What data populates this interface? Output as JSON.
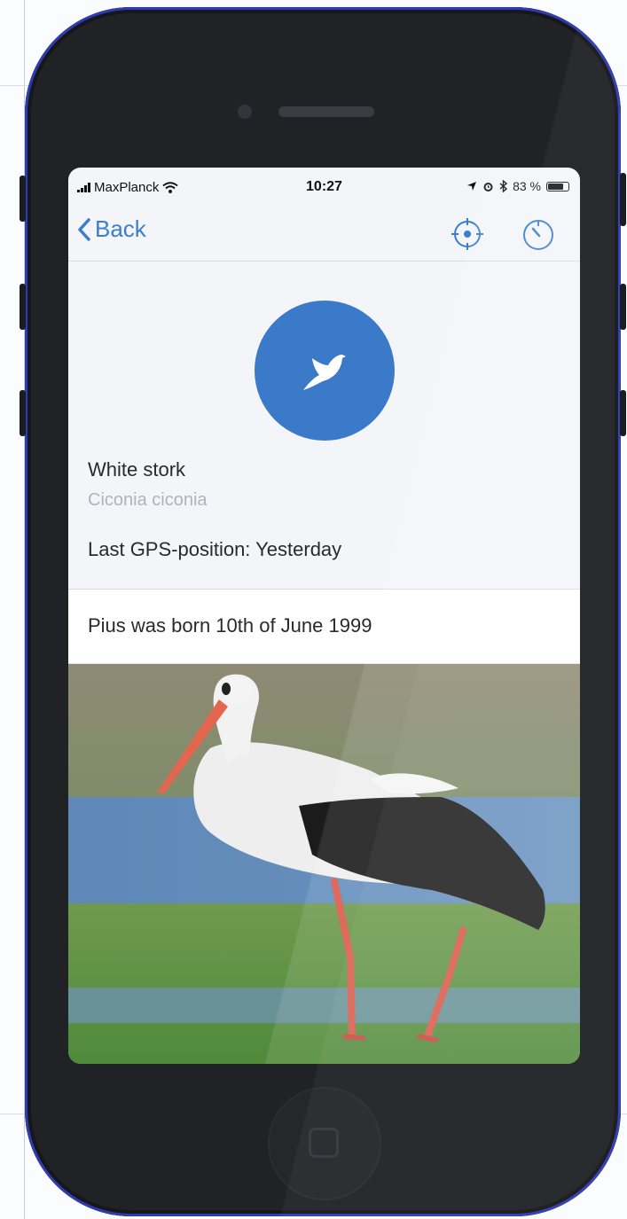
{
  "status_bar": {
    "carrier": "MaxPlanck",
    "time": "10:27",
    "battery": "83 %",
    "battery_level": 0.83
  },
  "nav": {
    "back_label": "Back",
    "icons": [
      "back-chevron-icon",
      "locate-target-icon",
      "timer-icon"
    ]
  },
  "animal": {
    "avatar_icon": "bird-icon",
    "common_name": "White stork",
    "latin_name": "Ciconia ciconia",
    "last_gps": "Last GPS-position: Yesterday",
    "born": "Pius was born 10th of June 1999"
  },
  "colors": {
    "accent": "#3b7ed0",
    "avatar": "#3a7ac9",
    "phone_body": "#202226"
  }
}
